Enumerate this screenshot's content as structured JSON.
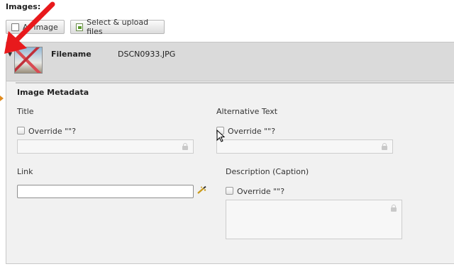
{
  "section": {
    "label": "Images:"
  },
  "toolbar": {
    "add_image_label": "Add image",
    "add_image_visible": "A",
    "add_image_rest": "image",
    "select_upload_label": "Select & upload files"
  },
  "file": {
    "filename_label": "Filename",
    "filename_value": "DSCN0933.JPG"
  },
  "metadata": {
    "heading": "Image Metadata",
    "title_label": "Title",
    "alt_label": "Alternative Text",
    "link_label": "Link",
    "description_label": "Description (Caption)",
    "override_label": "Override \"\"?",
    "link_value": ""
  },
  "annotation": {
    "arrow_color": "#e8191c"
  },
  "colors": {
    "header_bg": "#dadada",
    "panel_bg": "#f1f1f1",
    "marker": "#e08a1e"
  }
}
